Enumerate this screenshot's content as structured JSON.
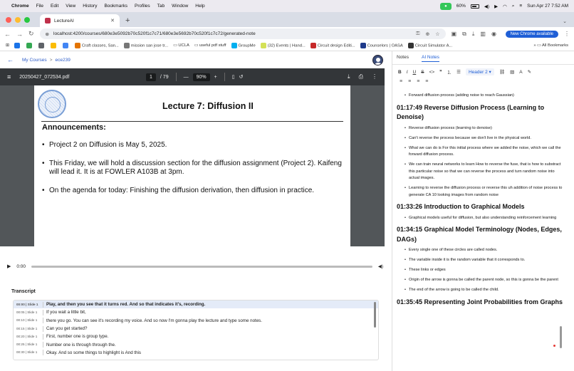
{
  "menubar": {
    "items": [
      "Chrome",
      "File",
      "Edit",
      "View",
      "History",
      "Bookmarks",
      "Profiles",
      "Tab",
      "Window",
      "Help"
    ],
    "battery": "60%",
    "clock": "Sun Apr 27  7:52 AM"
  },
  "browser": {
    "tab_title": "LectureAI",
    "url": "localhost:4200/courses/680e3e5092b70c520f1c7c71/680e3e5692b70c520f1c7c72/generated-note",
    "new_chrome": "New Chrome available",
    "bookmarks": [
      "Craft classes, San...",
      "mission san jose tr...",
      "UCLA",
      "useful pdf stuff",
      "GroupMe",
      "(32) Events | Hand...",
      "Circuit design Editi...",
      "Counselors | OASA",
      "Circuit Simulator A..."
    ],
    "all_bookmarks": "All Bookmarks"
  },
  "app": {
    "breadcrumb": {
      "courses": "My Courses",
      "sep": ">",
      "course": "ece239"
    }
  },
  "pdf": {
    "filename": "20250427_072534.pdf",
    "page": "1",
    "total": "/ 79",
    "zoom_out": "—",
    "zoom": "90%",
    "zoom_in": "+",
    "slide": {
      "title": "Lecture 7: Diffusion II",
      "heading": "Announcements:",
      "bullets": [
        "Project 2 on Diffusion is May 5, 2025.",
        "This Friday, we will hold a discussion section for the diffusion assignment (Project 2). Kaifeng will lead it. It is at FOWLER A103B at 3pm.",
        "On the agenda for today: Finishing the diffusion derivation, then diffusion in practice."
      ]
    }
  },
  "player": {
    "time": "0:00"
  },
  "transcript": {
    "title": "Transcript",
    "rows": [
      {
        "time": "00:00 | Slide 1",
        "text": "Play, and then you see that it turns red. And so that indicates it's, recording."
      },
      {
        "time": "00:05 | Slide 1",
        "text": "If you wait a little bit,"
      },
      {
        "time": "00:10 | Slide 1",
        "text": "there you go. You can see it's recording my voice. And so now I'm gonna play the lecture and type some notes."
      },
      {
        "time": "00:15 | Slide 1",
        "text": "Can you get started?"
      },
      {
        "time": "00:20 | Slide 1",
        "text": "First, number one is group type."
      },
      {
        "time": "00:25 | Slide 1",
        "text": "Number one is through through the."
      },
      {
        "time": "00:30 | Slide 1",
        "text": "Okay. And so some things to highlight is And this"
      }
    ]
  },
  "notes": {
    "tabs": [
      "Notes",
      "AI Notes"
    ],
    "toolbar": {
      "heading_select": "Header 2"
    },
    "sections": [
      {
        "title": "",
        "bullets": [
          "Forward diffusion process (adding noise to reach Gaussian)"
        ]
      },
      {
        "title": "01:17:49 Reverse Diffusion Process (Learning to Denoise)",
        "bullets": [
          "Reverse diffusion process (learning to denoise)",
          "Can't reverse the process because we don't live in the physical world.",
          "What we can do is For this initial process where we added the noise, which we call the forward diffusion process.",
          "We can train neural networks to learn How to reverse the fuse, that is how to substract this particular noise so that we can reverse the process and turn random noise into actual images.",
          "Learning to reverse the diffusion process or reverse this uh addition of noise process to generate CA 10 looking images from random noise"
        ]
      },
      {
        "title": "01:33:26 Introduction to Graphical Models",
        "bullets": [
          "Graphical models useful for diffusion, but also understanding reinforcement learning"
        ]
      },
      {
        "title": "01:34:15 Graphical Model Terminology (Nodes, Edges, DAGs)",
        "bullets": [
          "Every single one of these circles are called nodes.",
          "The variable inside it is the random variable that it corresponds to.",
          "These links or edges",
          "Origin of the arrow is gonna be called the parent node, so this is gonna be the parent",
          "The end of the arrow is going to be called the child."
        ]
      },
      {
        "title": "01:35:45 Representing Joint Probabilities from Graphs",
        "bullets": []
      }
    ]
  }
}
